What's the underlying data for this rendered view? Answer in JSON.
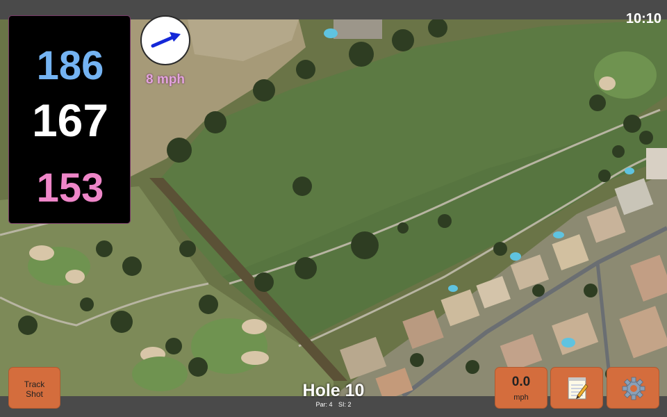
{
  "status_bar": {
    "time": "10:10"
  },
  "distances": {
    "back": "186",
    "middle": "167",
    "front": "153"
  },
  "wind": {
    "speed_label": "8 mph",
    "icon": "arrow-icon"
  },
  "hole": {
    "title": "Hole 10",
    "par_label": "Par: 4",
    "si_label": "SI: 2"
  },
  "buttons": {
    "track_shot_label": "Track\nShot",
    "speed_value": "0.0",
    "speed_unit": "mph",
    "notes_icon": "notepad-icon",
    "settings_icon": "gear-icon"
  },
  "colors": {
    "back_distance": "#74b3f2",
    "middle_distance": "#ffffff",
    "front_distance": "#ee86c8",
    "button_orange": "#d46d3d",
    "wind_label": "#e3a4dd"
  }
}
